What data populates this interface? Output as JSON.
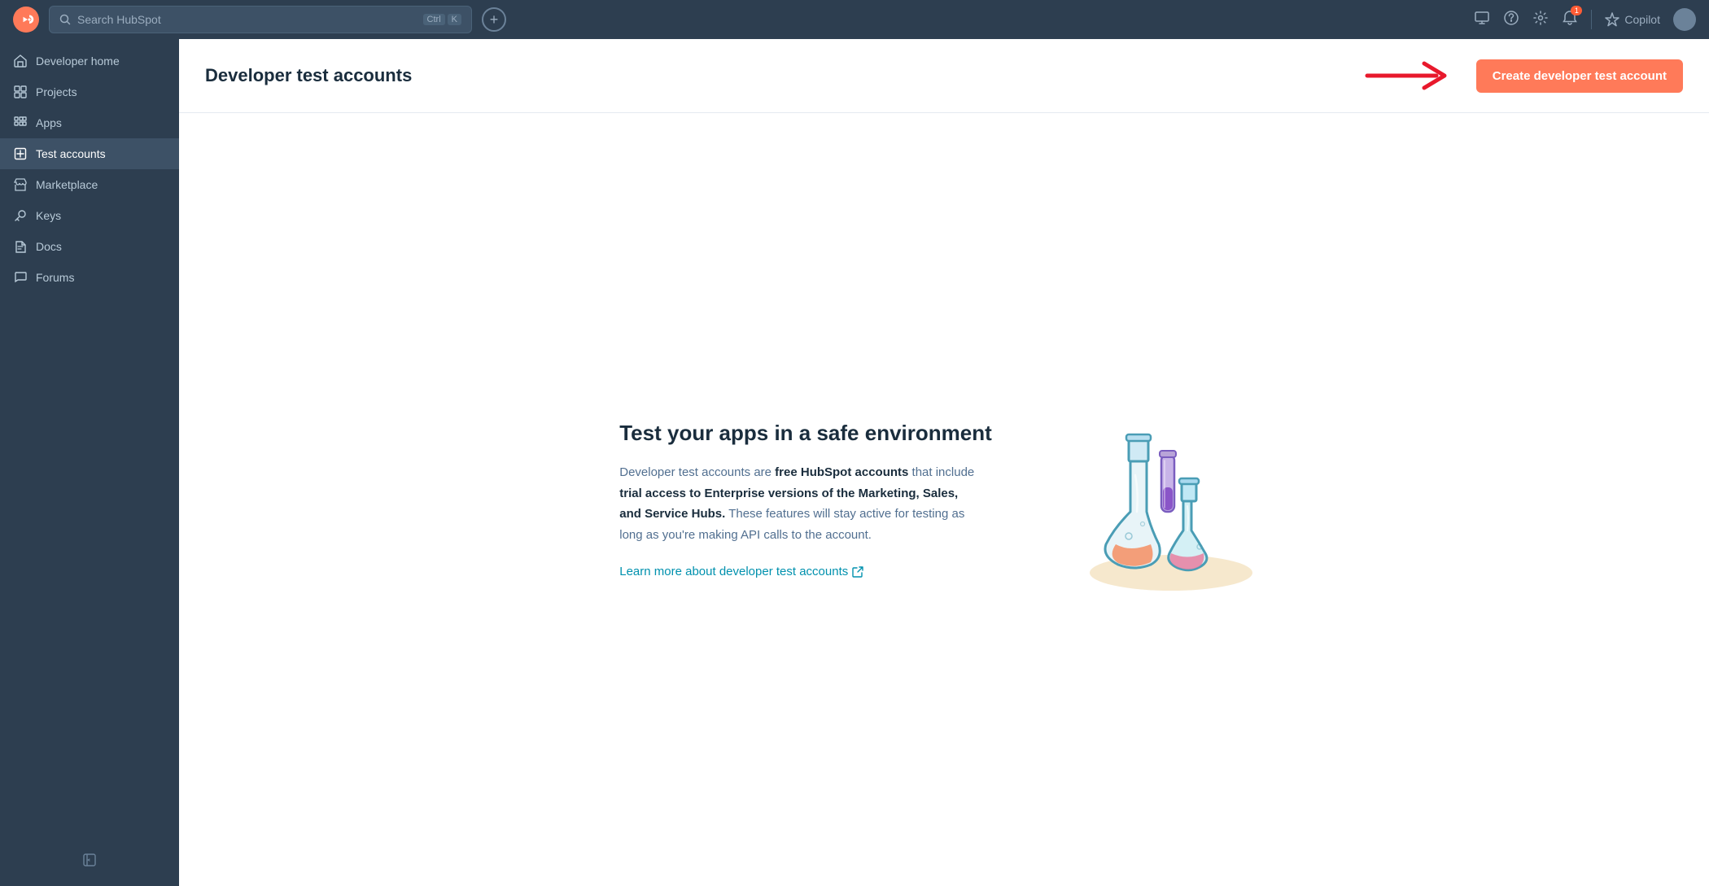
{
  "topnav": {
    "search_placeholder": "Search HubSpot",
    "shortcut_ctrl": "Ctrl",
    "shortcut_key": "K",
    "copilot_label": "Copilot",
    "notification_badge": "1"
  },
  "sidebar": {
    "items": [
      {
        "id": "developer-home",
        "label": "Developer home",
        "icon": "🏠",
        "active": false
      },
      {
        "id": "projects",
        "label": "Projects",
        "icon": "⊞",
        "active": false
      },
      {
        "id": "apps",
        "label": "Apps",
        "icon": "▦",
        "active": false
      },
      {
        "id": "test-accounts",
        "label": "Test accounts",
        "icon": "⊡",
        "active": true
      },
      {
        "id": "marketplace",
        "label": "Marketplace",
        "icon": "🏪",
        "active": false
      },
      {
        "id": "keys",
        "label": "Keys",
        "icon": "✂",
        "active": false
      },
      {
        "id": "docs",
        "label": "Docs",
        "icon": "</>",
        "active": false
      },
      {
        "id": "forums",
        "label": "Forums",
        "icon": "💬",
        "active": false
      }
    ]
  },
  "page": {
    "title": "Developer test accounts",
    "create_button_label": "Create developer test account"
  },
  "empty_state": {
    "heading": "Test your apps in a safe environment",
    "description_intro": "Developer test accounts are ",
    "description_bold1": "free HubSpot accounts",
    "description_mid": " that include ",
    "description_bold2": "trial access to Enterprise versions of the Marketing, Sales, and Service Hubs.",
    "description_end": " These features will stay active for testing as long as you're making API calls to the account.",
    "learn_link": "Learn more about developer test accounts"
  }
}
